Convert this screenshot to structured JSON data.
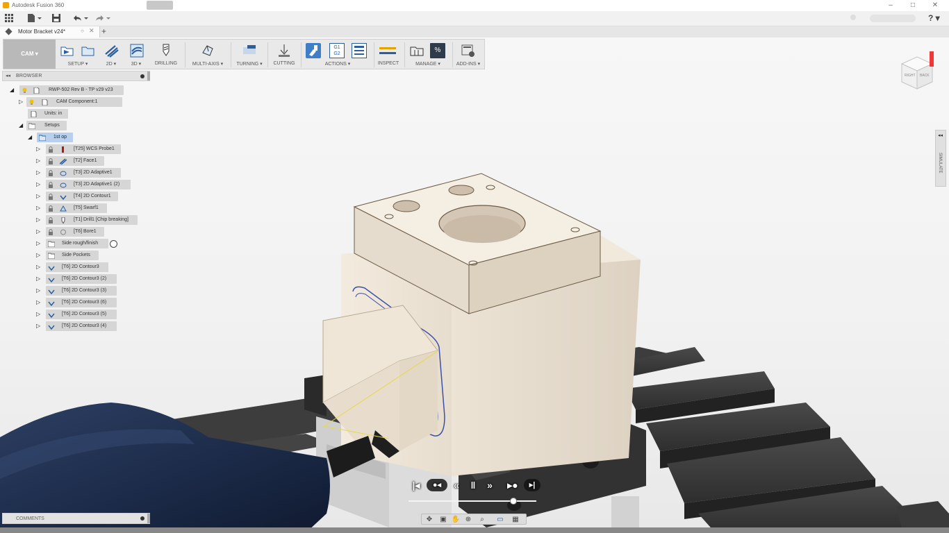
{
  "window": {
    "title": "Autodesk Fusion 360",
    "controls": {
      "minimize": "–",
      "maximize": "□",
      "close": "✕"
    }
  },
  "quick_access": {
    "grid_icon": "app-grid-icon",
    "file_icon": "file-icon",
    "save_icon": "save-icon",
    "undo_icon": "undo-icon",
    "redo_icon": "redo-icon",
    "help_label": "?"
  },
  "document": {
    "tab_title": "Motor Bracket v24*",
    "new_tab_label": "+"
  },
  "toolbar": {
    "workspace_label": "CAM ▾",
    "groups": [
      {
        "label": "SETUP ▾"
      },
      {
        "label": "2D ▾"
      },
      {
        "label": "3D ▾"
      },
      {
        "label": "DRILLING"
      },
      {
        "label": "MULTI-AXIS ▾"
      },
      {
        "label": "TURNING ▾"
      },
      {
        "label": "CUTTING"
      },
      {
        "label": "ACTIONS ▾"
      },
      {
        "label": "INSPECT"
      },
      {
        "label": "MANAGE ▾"
      },
      {
        "label": "ADD-INS ▾"
      }
    ],
    "actions_icon_text": "G1\nG2"
  },
  "viewcube": {
    "left_face": "RIGHT",
    "right_face": "BACK"
  },
  "browser": {
    "title": "BROWSER",
    "collapse_label": "◂◂",
    "items": [
      {
        "label": "RWP-502 Rev B - TP v29 v23",
        "icon": "document-icon"
      },
      {
        "label": "CAM Component:1",
        "icon": "component-icon"
      },
      {
        "label": "Units: in",
        "icon": "units-icon"
      },
      {
        "label": "Setups",
        "icon": "setups-folder-icon"
      },
      {
        "label": "1st op",
        "icon": "setup-icon"
      },
      {
        "label": "[T25] WCS Probe1",
        "icon": "probe-icon"
      },
      {
        "label": "[T2] Face1",
        "icon": "face-op-icon"
      },
      {
        "label": "[T3] 2D Adaptive1",
        "icon": "adaptive-op-icon"
      },
      {
        "label": "[T3] 2D Adaptive1 (2)",
        "icon": "adaptive-op-icon"
      },
      {
        "label": "[T4] 2D Contour1",
        "icon": "contour-op-icon"
      },
      {
        "label": "[T5] Swarf1",
        "icon": "swarf-op-icon"
      },
      {
        "label": "[T1] Drill1 [Chip breaking]",
        "icon": "drill-op-icon"
      },
      {
        "label": "[T6] Bore1",
        "icon": "bore-op-icon"
      },
      {
        "label": "Side rough/finish",
        "icon": "folder-icon"
      },
      {
        "label": "Side Pockets",
        "icon": "folder-icon"
      },
      {
        "label": "[T6] 2D Contour3",
        "icon": "contour-op-icon"
      },
      {
        "label": "[T6] 2D Contour3 (2)",
        "icon": "contour-op-icon"
      },
      {
        "label": "[T6] 2D Contour3 (3)",
        "icon": "contour-op-icon"
      },
      {
        "label": "[T6] 2D Contour3 (6)",
        "icon": "contour-op-icon"
      },
      {
        "label": "[T6] 2D Contour3 (5)",
        "icon": "contour-op-icon"
      },
      {
        "label": "[T6] 2D Contour3 (4)",
        "icon": "contour-op-icon"
      }
    ]
  },
  "simulate_tab": {
    "collapse_label": "◂◂",
    "label": "SIMULATE"
  },
  "comments": {
    "title": "COMMENTS"
  },
  "playback": {
    "first_label": "|◂",
    "prev_op_label": "●◂",
    "back_label": "«",
    "pause_label": "‖",
    "forward_label": "»",
    "next_op_label": "▸●",
    "last_label": "▸|",
    "progress": 0.82
  },
  "navbar": {
    "icons": [
      "orbit-icon",
      "look-at-icon",
      "pan-icon",
      "zoom-icon",
      "zoom-window-icon",
      "display-settings-icon",
      "grid-icon"
    ]
  },
  "colors": {
    "part": "#efe6d8",
    "toolpath": "#3a4fa8",
    "tool_holder": "#1c2c48",
    "table": "#3a3a3a",
    "selection": "#b8d0ee",
    "lightbulb": "#f2c200"
  }
}
